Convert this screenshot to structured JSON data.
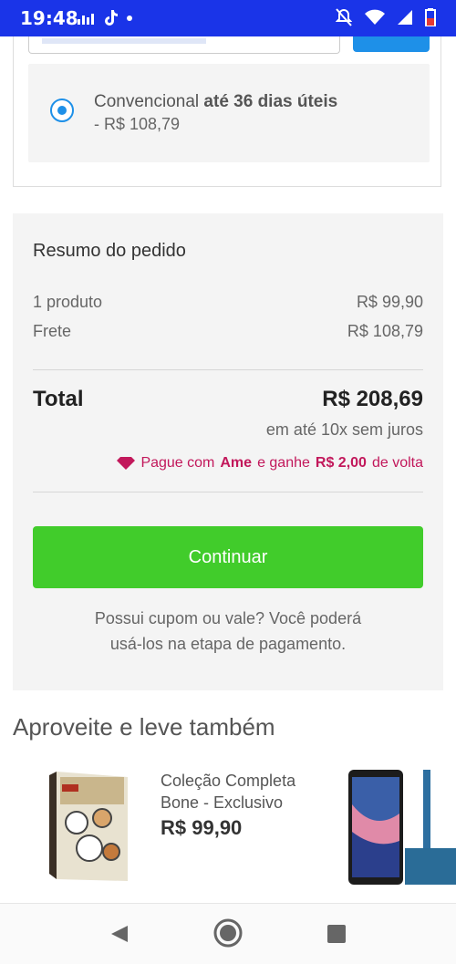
{
  "status_bar": {
    "time": "19:48"
  },
  "shipping": {
    "option_name": "Convencional",
    "option_deadline": "até 36 dias úteis",
    "option_price": "- R$ 108,79"
  },
  "summary": {
    "title": "Resumo do pedido",
    "products_label": "1 produto",
    "products_value": "R$ 99,90",
    "shipping_label": "Frete",
    "shipping_value": "R$ 108,79",
    "total_label": "Total",
    "total_value": "R$ 208,69",
    "installments": "em até 10x sem juros",
    "ame_prefix": "Pague com",
    "ame_brand": "Ame",
    "ame_middle": "e ganhe",
    "ame_amount": "R$ 2,00",
    "ame_suffix": "de volta",
    "continue_label": "Continuar",
    "coupon_line1": "Possui cupom ou vale? Você poderá",
    "coupon_line2": "usá-los na etapa de pagamento."
  },
  "recommendations": {
    "title": "Aproveite e leve também",
    "items": [
      {
        "name_line1": "Coleção Completa",
        "name_line2": "Bone - Exclusivo",
        "price": "R$ 99,90"
      }
    ]
  },
  "colors": {
    "status_bar": "#1a34e8",
    "continue": "#41cc2b",
    "ame": "#c2185b",
    "radio": "#1e90e8"
  },
  "icons": [
    "tiktok-icon",
    "wifi-icon",
    "signal-icon",
    "battery-icon",
    "diamond-icon",
    "back-icon",
    "home-icon",
    "recent-apps-icon"
  ]
}
